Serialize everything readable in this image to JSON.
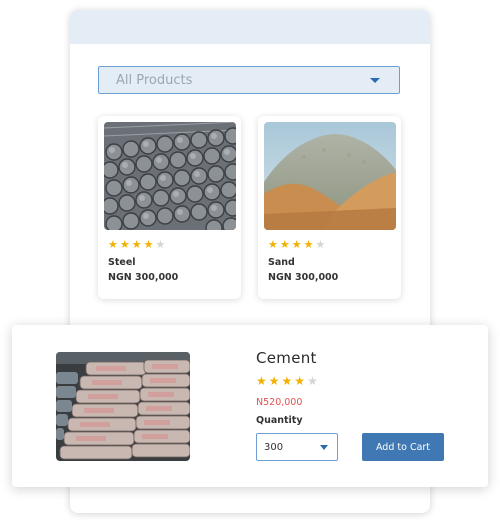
{
  "filter": {
    "selected": "All Products"
  },
  "products": [
    {
      "name": "Steel",
      "price": "NGN 300,000",
      "rating": 4,
      "max_rating": 5
    },
    {
      "name": "Sand",
      "price": "NGN 300,000",
      "rating": 4,
      "max_rating": 5
    }
  ],
  "detail": {
    "title": "Cement",
    "rating": 4,
    "max_rating": 5,
    "price": "N520,000",
    "quantity_label": "Quantity",
    "quantity_value": "300",
    "add_to_cart_label": "Add to Cart"
  },
  "colors": {
    "accent": "#3f78b2",
    "header_bg": "#e4ecf6",
    "star": "#f2b100",
    "price_red": "#e05151"
  }
}
